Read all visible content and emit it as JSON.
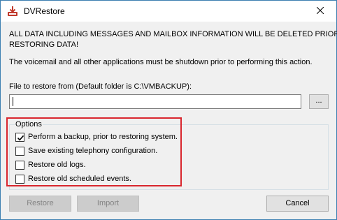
{
  "window": {
    "title": "DVRestore"
  },
  "message": {
    "warning_line1": "ALL DATA INCLUDING MESSAGES AND MAILBOX INFORMATION WILL BE DELETED PRIOR TO",
    "warning_line2": "RESTORING DATA!",
    "note": "The voicemail and all other applications must be shutdown prior to performing this action."
  },
  "file": {
    "label": "File to restore from (Default folder is C:\\VMBACKUP):",
    "value": "",
    "browse_label": "..."
  },
  "options": {
    "legend": "Options",
    "items": [
      {
        "label": "Perform a backup, prior to restoring system.",
        "checked": true
      },
      {
        "label": "Save existing telephony configuration.",
        "checked": false
      },
      {
        "label": "Restore old logs.",
        "checked": false
      },
      {
        "label": "Restore old scheduled events.",
        "checked": false
      }
    ]
  },
  "buttons": {
    "restore": "Restore",
    "import": "Import",
    "cancel": "Cancel"
  },
  "colors": {
    "highlight": "#d9262e",
    "title_border": "#3c7fb1"
  }
}
